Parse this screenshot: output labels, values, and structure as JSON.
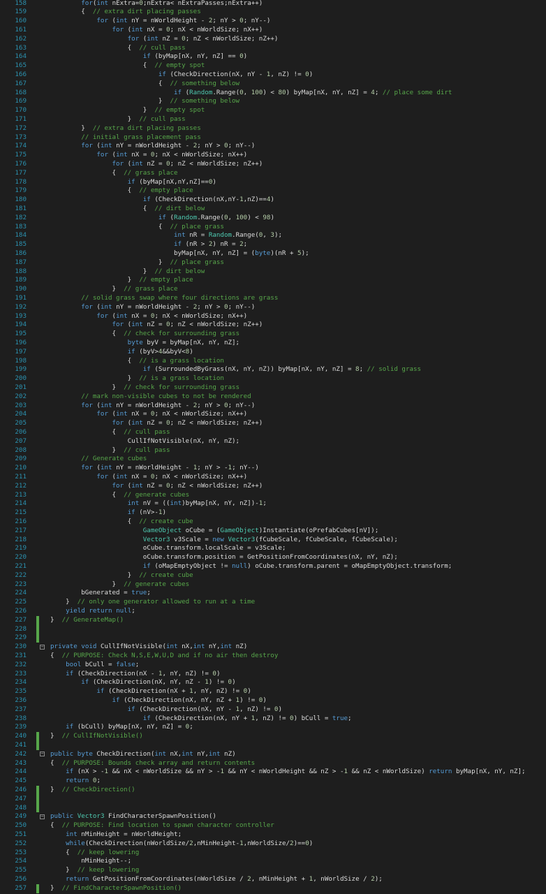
{
  "editor": {
    "theme_colors": {
      "background": "#1e1e1e",
      "line_number": "#2b91af",
      "keyword": "#569cd6",
      "type": "#4ec9b0",
      "comment": "#57a64a",
      "number": "#b5cea8",
      "text": "#dcdcdc",
      "change_marker": "#57a64a"
    },
    "lines": [
      {
        "n": "158",
        "t": "        for(int nExtra=0;nExtra< nExtraPasses;nExtra++)"
      },
      {
        "n": "159",
        "t": "        {  // extra dirt placing passes"
      },
      {
        "n": "160",
        "t": "            for (int nY = nWorldHeight - 2; nY > 0; nY--)"
      },
      {
        "n": "161",
        "t": "                for (int nX = 0; nX < nWorldSize; nX++)"
      },
      {
        "n": "162",
        "t": "                    for (int nZ = 0; nZ < nWorldSize; nZ++)"
      },
      {
        "n": "163",
        "t": "                    {  // cull pass"
      },
      {
        "n": "164",
        "t": "                        if (byMap[nX, nY, nZ] == 0)"
      },
      {
        "n": "165",
        "t": "                        {  // empty spot"
      },
      {
        "n": "166",
        "t": "                            if (CheckDirection(nX, nY - 1, nZ) != 0)"
      },
      {
        "n": "167",
        "t": "                            {  // something below"
      },
      {
        "n": "168",
        "t": "                                if (Random.Range(0, 100) < 80) byMap[nX, nY, nZ] = 4; // place some dirt"
      },
      {
        "n": "169",
        "t": "                            }  // something below"
      },
      {
        "n": "170",
        "t": "                        }  // empty spot"
      },
      {
        "n": "171",
        "t": "                    }  // cull pass"
      },
      {
        "n": "172",
        "t": "        }  // extra dirt placing passes"
      },
      {
        "n": "173",
        "t": "        // initial grass placement pass"
      },
      {
        "n": "174",
        "t": "        for (int nY = nWorldHeight - 2; nY > 0; nY--)"
      },
      {
        "n": "175",
        "t": "            for (int nX = 0; nX < nWorldSize; nX++)"
      },
      {
        "n": "176",
        "t": "                for (int nZ = 0; nZ < nWorldSize; nZ++)"
      },
      {
        "n": "177",
        "t": "                {  // grass place"
      },
      {
        "n": "178",
        "t": "                    if (byMap[nX,nY,nZ]==0)"
      },
      {
        "n": "179",
        "t": "                    {  // empty place"
      },
      {
        "n": "180",
        "t": "                        if (CheckDirection(nX,nY-1,nZ)==4)"
      },
      {
        "n": "181",
        "t": "                        {  // dirt below"
      },
      {
        "n": "182",
        "t": "                            if (Random.Range(0, 100) < 98)"
      },
      {
        "n": "183",
        "t": "                            {  // place grass"
      },
      {
        "n": "184",
        "t": "                                int nR = Random.Range(0, 3);"
      },
      {
        "n": "185",
        "t": "                                if (nR > 2) nR = 2;"
      },
      {
        "n": "186",
        "t": "                                byMap[nX, nY, nZ] = (byte)(nR + 5);"
      },
      {
        "n": "187",
        "t": "                            }  // place grass"
      },
      {
        "n": "188",
        "t": "                        }  // dirt below"
      },
      {
        "n": "189",
        "t": "                    }  // empty place"
      },
      {
        "n": "190",
        "t": "                }  // grass place"
      },
      {
        "n": "191",
        "t": "        // solid grass swap where four directions are grass"
      },
      {
        "n": "192",
        "t": "        for (int nY = nWorldHeight - 2; nY > 0; nY--)"
      },
      {
        "n": "193",
        "t": "            for (int nX = 0; nX < nWorldSize; nX++)"
      },
      {
        "n": "194",
        "t": "                for (int nZ = 0; nZ < nWorldSize; nZ++)"
      },
      {
        "n": "195",
        "t": "                {  // check for surrounding grass"
      },
      {
        "n": "196",
        "t": "                    byte byV = byMap[nX, nY, nZ];"
      },
      {
        "n": "197",
        "t": "                    if (byV>4&&byV<8)"
      },
      {
        "n": "198",
        "t": "                    {  // is a grass location"
      },
      {
        "n": "199",
        "t": "                        if (SurroundedByGrass(nX, nY, nZ)) byMap[nX, nY, nZ] = 8; // solid grass"
      },
      {
        "n": "200",
        "t": "                    }  // is a grass location"
      },
      {
        "n": "201",
        "t": "                }  // check for surrounding grass"
      },
      {
        "n": "202",
        "t": "        // mark non-visible cubes to not be rendered"
      },
      {
        "n": "203",
        "t": "        for (int nY = nWorldHeight - 2; nY > 0; nY--)"
      },
      {
        "n": "204",
        "t": "            for (int nX = 0; nX < nWorldSize; nX++)"
      },
      {
        "n": "205",
        "t": "                for (int nZ = 0; nZ < nWorldSize; nZ++)"
      },
      {
        "n": "206",
        "t": "                {  // cull pass"
      },
      {
        "n": "207",
        "t": "                    CullIfNotVisible(nX, nY, nZ);"
      },
      {
        "n": "208",
        "t": "                }  // cull pass"
      },
      {
        "n": "209",
        "t": "        // Generate cubes"
      },
      {
        "n": "210",
        "t": "        for (int nY = nWorldHeight - 1; nY > -1; nY--)"
      },
      {
        "n": "211",
        "t": "            for (int nX = 0; nX < nWorldSize; nX++)"
      },
      {
        "n": "212",
        "t": "                for (int nZ = 0; nZ < nWorldSize; nZ++)"
      },
      {
        "n": "213",
        "t": "                {  // generate cubes"
      },
      {
        "n": "214",
        "t": "                    int nV = ((int)byMap[nX, nY, nZ])-1;"
      },
      {
        "n": "215",
        "t": "                    if (nV>-1)"
      },
      {
        "n": "216",
        "t": "                    {  // create cube"
      },
      {
        "n": "217",
        "t": "                        GameObject oCube = (GameObject)Instantiate(oPrefabCubes[nV]);"
      },
      {
        "n": "218",
        "t": "                        Vector3 v3Scale = new Vector3(fCubeScale, fCubeScale, fCubeScale);"
      },
      {
        "n": "219",
        "t": "                        oCube.transform.localScale = v3Scale;"
      },
      {
        "n": "220",
        "t": "                        oCube.transform.position = GetPositionFromCoordinates(nX, nY, nZ);"
      },
      {
        "n": "221",
        "t": "                        if (oMapEmptyObject != null) oCube.transform.parent = oMapEmptyObject.transform;"
      },
      {
        "n": "222",
        "t": "                    }  // create cube"
      },
      {
        "n": "223",
        "t": "                }  // generate cubes"
      },
      {
        "n": "224",
        "t": "        bGenerated = true;"
      },
      {
        "n": "225",
        "t": "    }  // only one generator allowed to run at a time"
      },
      {
        "n": "226",
        "t": "    yield return null;"
      },
      {
        "n": "227",
        "t": "}  // GenerateMap()"
      },
      {
        "n": "228",
        "t": ""
      },
      {
        "n": "229",
        "t": ""
      },
      {
        "n": "230",
        "t": "private void CullIfNotVisible(int nX,int nY,int nZ)"
      },
      {
        "n": "231",
        "t": "{  // PURPOSE: Check N,S,E,W,U,D and if no air then destroy"
      },
      {
        "n": "232",
        "t": "    bool bCull = false;"
      },
      {
        "n": "233",
        "t": "    if (CheckDirection(nX - 1, nY, nZ) != 0)"
      },
      {
        "n": "234",
        "t": "        if (CheckDirection(nX, nY, nZ - 1) != 0)"
      },
      {
        "n": "235",
        "t": "            if (CheckDirection(nX + 1, nY, nZ) != 0)"
      },
      {
        "n": "236",
        "t": "                if (CheckDirection(nX, nY, nZ + 1) != 0)"
      },
      {
        "n": "237",
        "t": "                    if (CheckDirection(nX, nY - 1, nZ) != 0)"
      },
      {
        "n": "238",
        "t": "                        if (CheckDirection(nX, nY + 1, nZ) != 0) bCull = true;"
      },
      {
        "n": "239",
        "t": "    if (bCull) byMap[nX, nY, nZ] = 0;"
      },
      {
        "n": "240",
        "t": "}  // CullIfNotVisible()"
      },
      {
        "n": "241",
        "t": ""
      },
      {
        "n": "242",
        "t": "public byte CheckDirection(int nX,int nY,int nZ)"
      },
      {
        "n": "243",
        "t": "{  // PURPOSE: Bounds check array and return contents"
      },
      {
        "n": "244",
        "t": "    if (nX > -1 && nX < nWorldSize && nY > -1 && nY < nWorldHeight && nZ > -1 && nZ < nWorldSize) return byMap[nX, nY, nZ];"
      },
      {
        "n": "245",
        "t": "    return 0;"
      },
      {
        "n": "246",
        "t": "}  // CheckDirection()"
      },
      {
        "n": "247",
        "t": ""
      },
      {
        "n": "248",
        "t": ""
      },
      {
        "n": "249",
        "t": "public Vector3 FindCharacterSpawnPosition()"
      },
      {
        "n": "250",
        "t": "{  // PURPOSE: Find location to spawn character controller"
      },
      {
        "n": "251",
        "t": "    int nMinHeight = nWorldHeight;"
      },
      {
        "n": "252",
        "t": "    while(CheckDirection(nWorldSize/2,nMinHeight-1,nWorldSize/2)==0)"
      },
      {
        "n": "253",
        "t": "    {  // keep lowering"
      },
      {
        "n": "254",
        "t": "        nMinHeight--;"
      },
      {
        "n": "255",
        "t": "    }  // keep lowering"
      },
      {
        "n": "256",
        "t": "    return GetPositionFromCoordinates(nWorldSize / 2, nMinHeight + 1, nWorldSize / 2);"
      },
      {
        "n": "257",
        "t": "}  // FindCharacterSpawnPosition()"
      }
    ],
    "modified_lines": [
      "227",
      "228",
      "229",
      "240",
      "241",
      "246",
      "247",
      "248",
      "257"
    ],
    "fold_lines": [
      "230",
      "242",
      "249"
    ],
    "fold_glyph": "−"
  }
}
